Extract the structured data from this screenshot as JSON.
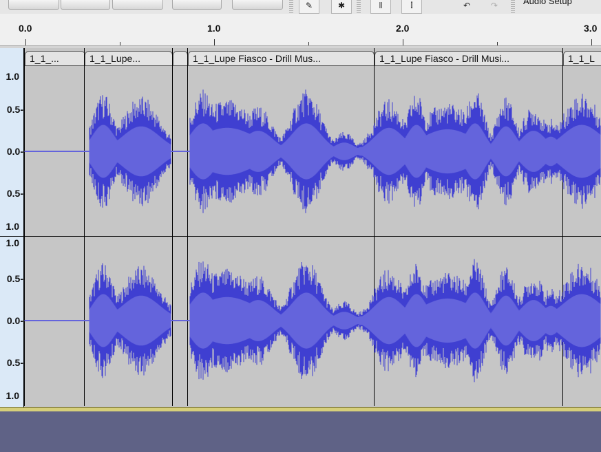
{
  "toolbar": {
    "audio_setup_label": "Audio Setup",
    "draw_tool_icon": "pencil-icon",
    "multi_tool_icon": "multi-tool-icon",
    "zoom_icons": [
      "zoom-normal-icon",
      "zoom-fit-icon"
    ],
    "undo_icon": "undo-icon",
    "redo_icon": "redo-icon"
  },
  "ruler": {
    "ticks": [
      "0.0",
      "1.0",
      "2.0",
      "3.0"
    ]
  },
  "vertical_scale": {
    "labels_top": [
      "1.0",
      "0.5-",
      "0.0-",
      "0.5-",
      "1.0"
    ],
    "labels_bottom": [
      "1.0",
      "0.5-",
      "0.0-",
      "0.5-",
      "1.0"
    ]
  },
  "clips": [
    {
      "title": "1_1_..."
    },
    {
      "title": "1_1_Lupe..."
    },
    {
      "title": ""
    },
    {
      "title": "1_1_Lupe Fiasco - Drill Mus..."
    },
    {
      "title": "1_1_Lupe Fiasco - Drill Musi..."
    },
    {
      "title": "1_1_L"
    }
  ],
  "colors": {
    "waveform": "#3f3fd1",
    "waveform_rms": "#6464dc",
    "clip_bg": "#c6c6c6",
    "scale_bg": "#dbe9f7",
    "background": "#5f6286"
  }
}
